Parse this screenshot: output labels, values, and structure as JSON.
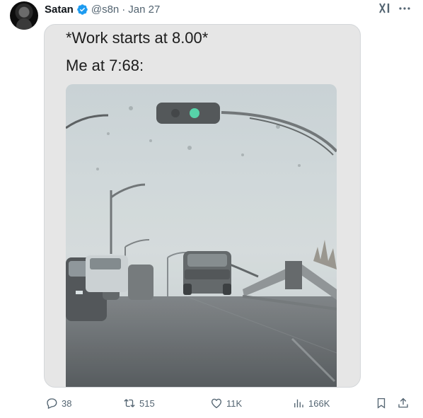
{
  "tweet": {
    "author_name": "Satan",
    "handle": "@s8n",
    "separator": "·",
    "date": "Jan 27",
    "caption_line1": "*Work starts at 8.00*",
    "caption_line2": "Me at 7:68:"
  },
  "actions": {
    "replies": "38",
    "retweets": "515",
    "likes": "11K",
    "views": "166K"
  },
  "icons": {
    "verified": "verified-badge-icon",
    "grok": "grok-icon",
    "more": "more-icon",
    "reply": "reply-icon",
    "retweet": "retweet-icon",
    "like": "heart-icon",
    "views": "views-chart-icon",
    "bookmark": "bookmark-icon",
    "share": "share-icon"
  },
  "colors": {
    "text": "#0f1419",
    "muted": "#536471",
    "verified": "#1d9bf0",
    "card_bg": "#e6e6e6",
    "traffic_light_green": "#4fd1a5"
  }
}
